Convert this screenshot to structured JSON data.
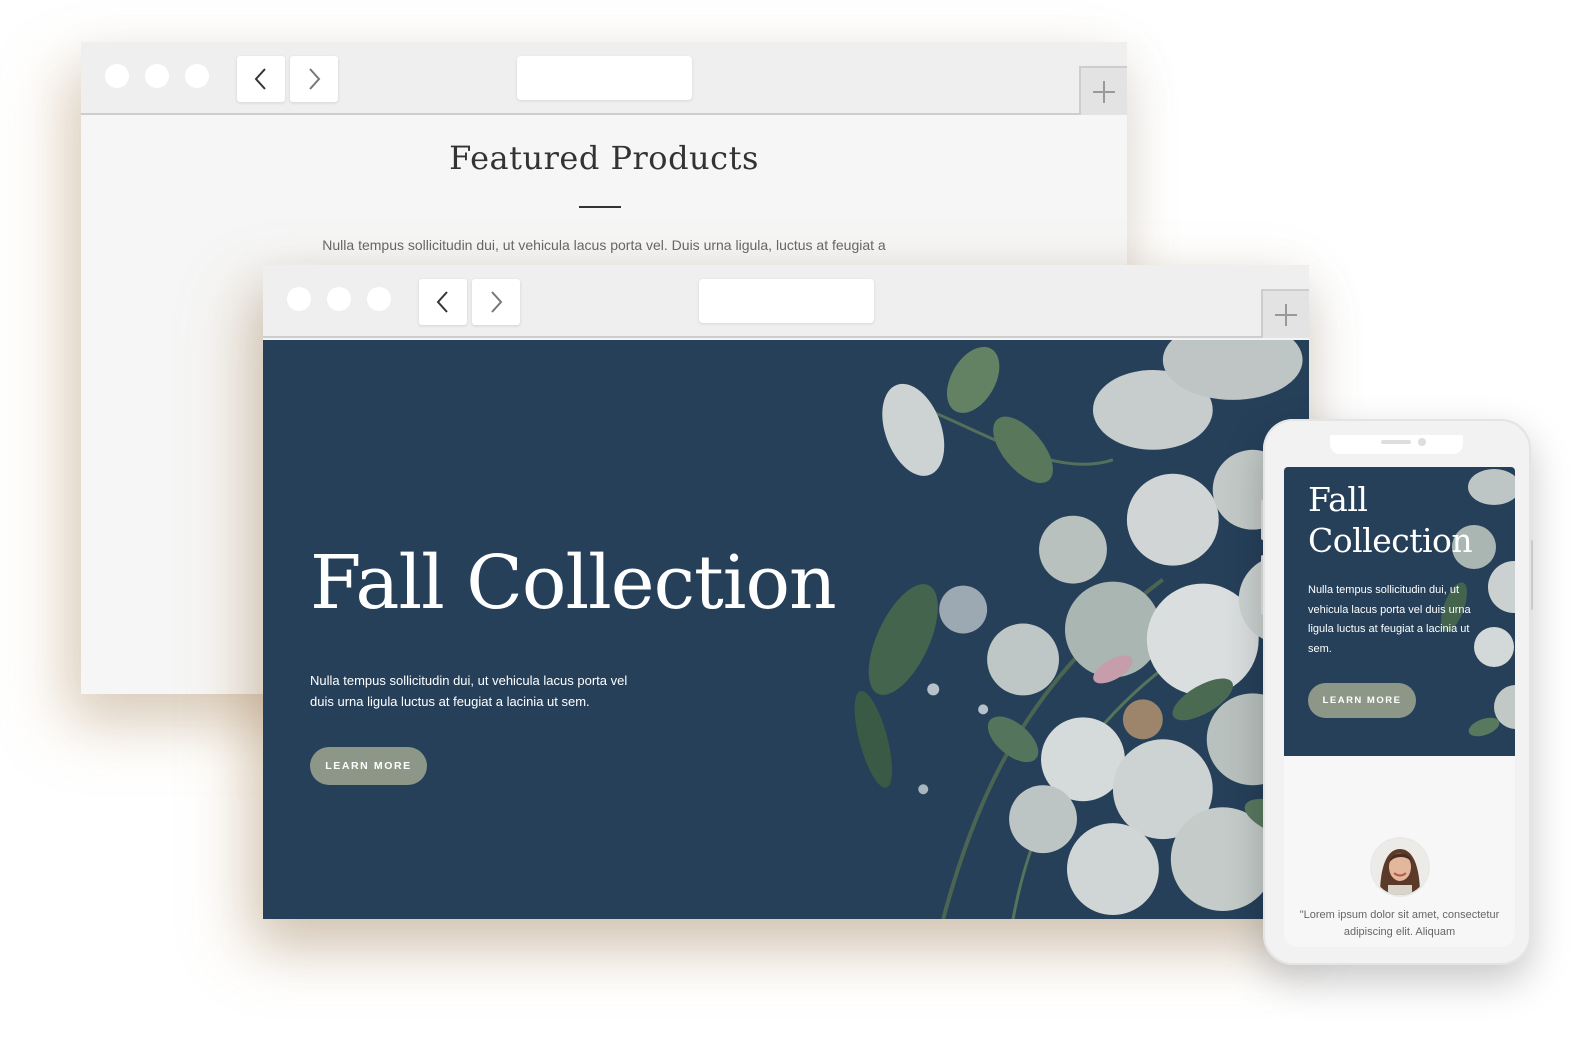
{
  "back_window": {
    "heading": "Featured Products",
    "body_text": "Nulla tempus sollicitudin dui, ut vehicula lacus porta vel. Duis urna ligula, luctus at feugiat a"
  },
  "front_window": {
    "hero_title": "Fall Collection",
    "hero_text": "Nulla tempus sollicitudin dui, ut vehicula lacus porta vel duis urna ligula luctus at feugiat a lacinia ut sem.",
    "cta_label": "LEARN MORE"
  },
  "mobile": {
    "hero_title": "Fall Collection",
    "hero_text": "Nulla tempus sollicitudin dui, ut vehicula lacus porta vel duis urna ligula luctus at feugiat a lacinia ut sem.",
    "cta_label": "LEARN MORE",
    "testimonial": "\"Lorem ipsum dolor sit amet, consectetur adipiscing elit. Aliquam"
  },
  "icons": {
    "back": "chevron-left-icon",
    "forward": "chevron-right-icon",
    "new_tab": "plus-icon"
  },
  "colors": {
    "hero_background": "#26405a",
    "button": "#8d9788",
    "chrome": "#efefef"
  }
}
